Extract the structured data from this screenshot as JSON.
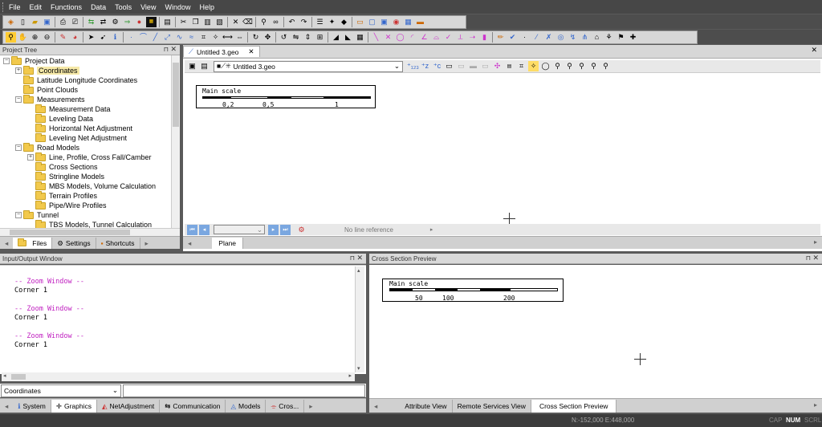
{
  "menu": [
    "File",
    "Edit",
    "Functions",
    "Data",
    "Tools",
    "View",
    "Window",
    "Help"
  ],
  "project_tree": {
    "title": "Project Tree",
    "items": [
      {
        "label": "Project Data",
        "level": 0,
        "expander": "−"
      },
      {
        "label": "Coordinates",
        "level": 1,
        "expander": "+",
        "selected": true
      },
      {
        "label": "Latitude Longitude Coordinates",
        "level": 1
      },
      {
        "label": "Point Clouds",
        "level": 1
      },
      {
        "label": "Measurements",
        "level": 1,
        "expander": "−"
      },
      {
        "label": "Measurement Data",
        "level": 2
      },
      {
        "label": "Leveling Data",
        "level": 2
      },
      {
        "label": "Horizontal Net Adjustment",
        "level": 2
      },
      {
        "label": "Leveling Net Adjustment",
        "level": 2
      },
      {
        "label": "Road Models",
        "level": 1,
        "expander": "−"
      },
      {
        "label": "Line, Profile, Cross Fall/Camber",
        "level": 2,
        "expander": "+"
      },
      {
        "label": "Cross Sections",
        "level": 2
      },
      {
        "label": "Stringline Models",
        "level": 2
      },
      {
        "label": "MBS Models, Volume Calculation",
        "level": 2
      },
      {
        "label": "Terrain Profiles",
        "level": 2
      },
      {
        "label": "Pipe/Wire Profiles",
        "level": 2
      },
      {
        "label": "Tunnel",
        "level": 1,
        "expander": "−"
      },
      {
        "label": "TBS Models, Tunnel Calculation",
        "level": 2
      }
    ],
    "tabs": [
      "Files",
      "Settings",
      "Shortcuts"
    ]
  },
  "document": {
    "tab_label": "Untitled 3.geo",
    "file_select": "Untitled 3.geo",
    "scale_title": "Main scale",
    "scale_ticks": [
      "0,2",
      "0,5",
      "1"
    ],
    "line_reference": "No line reference",
    "bottom_tab": "Plane"
  },
  "io_window": {
    "title": "Input/Output Window",
    "lines": [
      {
        "text": "-- Zoom Window --",
        "kind": "cmd"
      },
      {
        "text": "Corner 1",
        "kind": "out"
      },
      {
        "text": "",
        "kind": "out"
      },
      {
        "text": "-- Zoom Window --",
        "kind": "cmd"
      },
      {
        "text": "Corner 1",
        "kind": "out"
      },
      {
        "text": "",
        "kind": "out"
      },
      {
        "text": "-- Zoom Window --",
        "kind": "cmd"
      },
      {
        "text": "Corner 1",
        "kind": "out"
      }
    ],
    "input_select": "Coordinates",
    "tabs": [
      "System",
      "Graphics",
      "NetAdjustment",
      "Communication",
      "Models",
      "Cros..."
    ]
  },
  "cross_section": {
    "title": "Cross Section Preview",
    "scale_title": "Main scale",
    "scale_ticks": [
      "50",
      "100",
      "200"
    ],
    "tabs": [
      "Attribute View",
      "Remote Services View",
      "Cross Section Preview"
    ]
  },
  "status": {
    "coords": "N:-152,000  E:448,000",
    "indicators": [
      "CAP",
      "NUM",
      "SCRL"
    ]
  }
}
